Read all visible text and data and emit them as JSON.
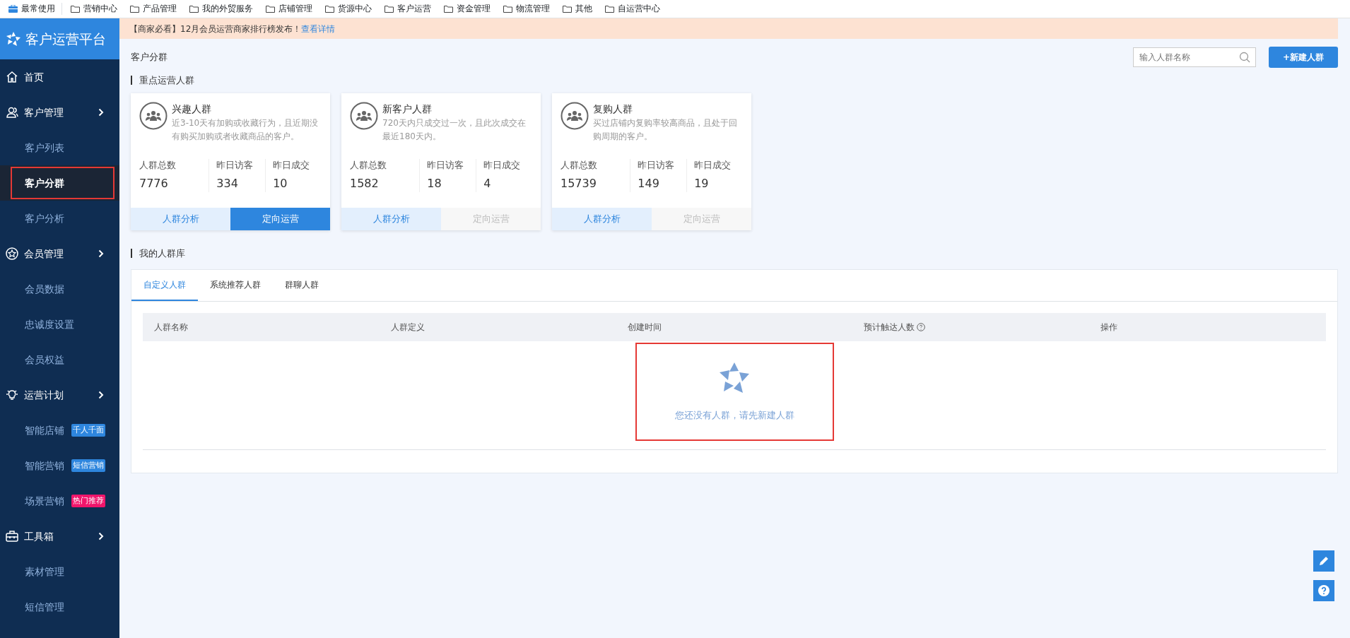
{
  "bookmarks": [
    {
      "label": "最常使用",
      "kind": "briefcase"
    },
    {
      "label": "营销中心",
      "kind": "folder"
    },
    {
      "label": "产品管理",
      "kind": "folder"
    },
    {
      "label": "我的外贸服务",
      "kind": "folder"
    },
    {
      "label": "店铺管理",
      "kind": "folder"
    },
    {
      "label": "货源中心",
      "kind": "folder"
    },
    {
      "label": "客户运营",
      "kind": "folder"
    },
    {
      "label": "资金管理",
      "kind": "folder"
    },
    {
      "label": "物流管理",
      "kind": "folder"
    },
    {
      "label": "其他",
      "kind": "folder"
    },
    {
      "label": "自运营中心",
      "kind": "folder"
    }
  ],
  "sidebar": {
    "title": "客户运营平台",
    "items": [
      {
        "label": "首页"
      },
      {
        "label": "客户管理",
        "children": [
          {
            "label": "客户列表",
            "selected": false
          },
          {
            "label": "客户分群",
            "selected": true
          },
          {
            "label": "客户分析",
            "selected": false
          }
        ]
      },
      {
        "label": "会员管理",
        "children": [
          {
            "label": "会员数据",
            "selected": false
          },
          {
            "label": "忠诚度设置",
            "selected": false
          },
          {
            "label": "会员权益",
            "selected": false
          }
        ]
      },
      {
        "label": "运营计划",
        "children": [
          {
            "label": "智能店铺",
            "selected": false,
            "tag": "千人千面",
            "color": "#2e86de"
          },
          {
            "label": "智能营销",
            "selected": false,
            "tag": "短信营销",
            "color": "#2e86de"
          },
          {
            "label": "场景营销",
            "selected": false,
            "tag": "热门推荐",
            "color": "#f0156b"
          }
        ]
      },
      {
        "label": "工具箱",
        "children": [
          {
            "label": "素材管理",
            "selected": false
          },
          {
            "label": "短信管理",
            "selected": false
          }
        ]
      }
    ]
  },
  "notice": {
    "text": "【商家必看】12月会员运营商家排行榜发布！",
    "link": "查看详情"
  },
  "page_title": "客户分群",
  "search": {
    "placeholder": "输入人群名称"
  },
  "new_button": "+新建人群",
  "featured": {
    "title": "重点运营人群",
    "cards": [
      {
        "name": "兴趣人群",
        "desc": "近3-10天有加购或收藏行为，且近期没有购买加购或者收藏商品的客户。",
        "stats": [
          {
            "label": "人群总数",
            "value": "7776"
          },
          {
            "label": "昨日访客",
            "value": "334"
          },
          {
            "label": "昨日成交",
            "value": "10"
          }
        ],
        "analyze": "人群分析",
        "target": "定向运营",
        "target_enabled": true
      },
      {
        "name": "新客户人群",
        "desc": "720天内只成交过一次，且此次成交在最近180天内。",
        "stats": [
          {
            "label": "人群总数",
            "value": "1582"
          },
          {
            "label": "昨日访客",
            "value": "18"
          },
          {
            "label": "昨日成交",
            "value": "4"
          }
        ],
        "analyze": "人群分析",
        "target": "定向运营",
        "target_enabled": false
      },
      {
        "name": "复购人群",
        "desc": "买过店铺内复购率较高商品，且处于回购周期的客户。",
        "stats": [
          {
            "label": "人群总数",
            "value": "15739"
          },
          {
            "label": "昨日访客",
            "value": "149"
          },
          {
            "label": "昨日成交",
            "value": "19"
          }
        ],
        "analyze": "人群分析",
        "target": "定向运营",
        "target_enabled": false
      }
    ]
  },
  "library": {
    "title": "我的人群库",
    "tabs": [
      {
        "label": "自定义人群",
        "selected": true
      },
      {
        "label": "系统推荐人群",
        "selected": false
      },
      {
        "label": "群聊人群",
        "selected": false
      }
    ],
    "table": {
      "columns": [
        {
          "label": "人群名称",
          "help": false
        },
        {
          "label": "人群定义",
          "help": false
        },
        {
          "label": "创建时间",
          "help": false
        },
        {
          "label": "预计触达人数",
          "help": true
        },
        {
          "label": "操作",
          "help": false
        }
      ],
      "empty_text": "您还没有人群，请先新建人群"
    }
  }
}
